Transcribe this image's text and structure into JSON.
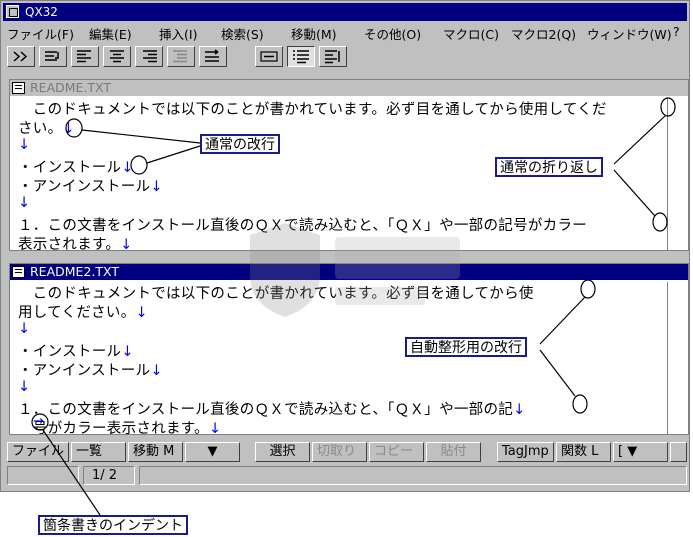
{
  "window": {
    "title": "QX32"
  },
  "menu": [
    "ファイル(F)",
    "編集(E)",
    "挿入(I)",
    "検索(S)",
    "移動(M)",
    "その他(O)",
    "マクロ(C)",
    "マクロ2(Q)",
    "ウィンドウ(W)",
    "?"
  ],
  "toolbar": [
    "wrap-icon",
    "wrap-newline-icon",
    "align-left-icon",
    "align-center-icon",
    "align-right-icon",
    "indent-icon",
    "wrap-arrow-icon",
    "frame-icon",
    "list-icon",
    "list-alt-icon"
  ],
  "pane1": {
    "title": "README.TXT",
    "lines": [
      {
        "text": "　このドキュメントでは以下のことが書かれています。必ず目を通してから使用してくだ",
        "mark": ""
      },
      {
        "text": "さい。",
        "mark": "↓"
      },
      {
        "text": "",
        "mark": "↓"
      },
      {
        "text": "・インストール",
        "mark": "↓"
      },
      {
        "text": "・アンインストール",
        "mark": "↓"
      },
      {
        "text": "",
        "mark": "↓"
      },
      {
        "text": "１．この文書をインストール直後のＱＸで読み込むと、「ＱＸ」や一部の記号がカラー",
        "mark": ""
      },
      {
        "text": "表示されます。",
        "mark": "↓"
      }
    ]
  },
  "pane2": {
    "title": "README2.TXT",
    "lines": [
      {
        "text": "　このドキュメントでは以下のことが書かれています。必ず目を通してから使",
        "mark": ""
      },
      {
        "text": "用してください。",
        "mark": "↓"
      },
      {
        "text": "",
        "mark": "↓"
      },
      {
        "text": "・インストール",
        "mark": "↓"
      },
      {
        "text": "・アンインストール",
        "mark": "↓"
      },
      {
        "text": "",
        "mark": "↓"
      },
      {
        "text": "１．この文書をインストール直後のＱＸで読み込むと、「ＱＸ」や一部の記",
        "mark": "↓"
      },
      {
        "text": "　号がカラー表示されます。",
        "mark": "↓"
      }
    ]
  },
  "funckeys": [
    {
      "label": "ファイル M",
      "enabled": true
    },
    {
      "label": "一覧",
      "enabled": true
    },
    {
      "label": "移動 M",
      "enabled": true
    },
    {
      "label": "▼",
      "enabled": true
    },
    {
      "label": "選択",
      "enabled": true
    },
    {
      "label": "切取り",
      "enabled": false
    },
    {
      "label": "コピー",
      "enabled": false
    },
    {
      "label": "貼付",
      "enabled": false
    },
    {
      "label": "TagJmp",
      "enabled": true
    },
    {
      "label": "関数 L",
      "enabled": true
    },
    {
      "label": "[ ▼",
      "enabled": true
    },
    {
      "label": "",
      "enabled": true
    }
  ],
  "status": {
    "page": "1/ 2"
  },
  "annotations": {
    "normal_newline": "通常の改行",
    "normal_wrap": "通常の折り返し",
    "auto_format_newline": "自動整形用の改行",
    "bullet_indent": "箇条書きのインデント"
  },
  "indent_mark": "→"
}
